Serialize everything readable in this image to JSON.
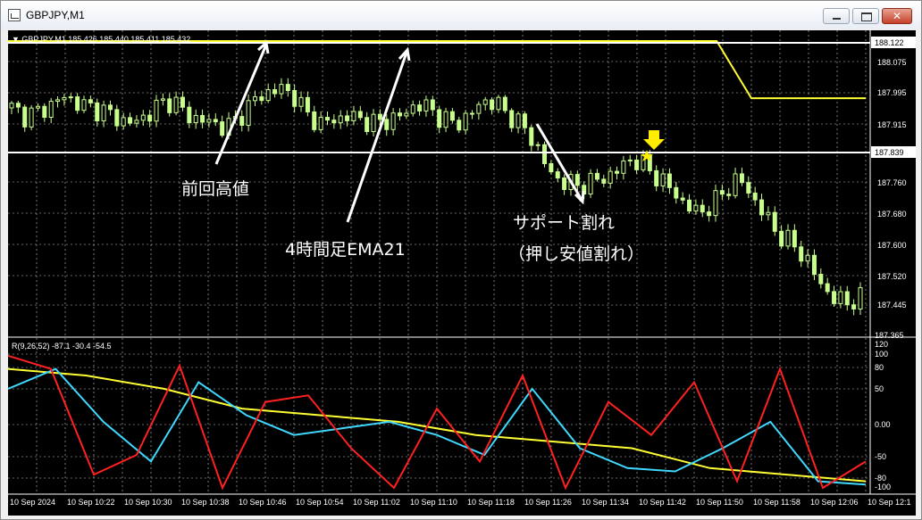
{
  "window": {
    "title": "GBPJPY,M1"
  },
  "main_header": "▼ GBPJPY,M1  185.426 185.440 185.411 185.432",
  "sub_header": "R(9,26,52) -87.1 -30.4 -54.5",
  "price_axis": {
    "ticks": [
      "188.075",
      "187.995",
      "187.915",
      "187.760",
      "187.680",
      "187.600",
      "187.520",
      "187.445",
      "187.365"
    ],
    "resistance_tag": "188.122",
    "support_tag": "187.839"
  },
  "osc_axis": {
    "ticks": [
      "120",
      "100",
      "80",
      "50",
      "0.00",
      "-50",
      "-80",
      "-100"
    ]
  },
  "time_axis": [
    "10 Sep 2024",
    "10 Sep 10:22",
    "10 Sep 10:30",
    "10 Sep 10:38",
    "10 Sep 10:46",
    "10 Sep 10:54",
    "10 Sep 11:02",
    "10 Sep 11:10",
    "10 Sep 11:18",
    "10 Sep 11:26",
    "10 Sep 11:34",
    "10 Sep 11:42",
    "10 Sep 11:50",
    "10 Sep 11:58",
    "10 Sep 12:06",
    "10 Sep 12:1"
  ],
  "annotations": {
    "prev_high": "前回高値",
    "ema_label": "4時間足EMA21",
    "support_break_1": "サポート割れ",
    "support_break_2": "（押し安値割れ）"
  },
  "colors": {
    "background": "#000000",
    "grid": "#c8c8c8",
    "candle": "#c8ff8c",
    "ema": "#ffff33",
    "level": "#ffffff",
    "osc_red": "#ff2020",
    "osc_cyan": "#3fd8ff",
    "osc_yellow": "#ffff33",
    "marker": "#ffee00"
  },
  "icons": {
    "entry_marker": "star-icon",
    "entry_arrow": "down-arrow-icon"
  },
  "chart_data": [
    {
      "type": "candlestick",
      "symbol": "GBPJPY",
      "timeframe": "M1",
      "ylim": [
        187.365,
        188.122
      ],
      "x": [
        "10:14",
        "10:22",
        "10:30",
        "10:38",
        "10:46",
        "10:54",
        "11:02",
        "11:10",
        "11:18",
        "11:26",
        "11:34",
        "11:42",
        "11:50",
        "11:58",
        "12:06",
        "12:14"
      ],
      "close_path": [
        187.95,
        187.93,
        187.94,
        187.96,
        187.98,
        187.96,
        187.95,
        187.94,
        187.92,
        187.91,
        187.93,
        187.96,
        187.97,
        187.93,
        187.92,
        187.91,
        187.9,
        187.93,
        187.97,
        187.99,
        188.0,
        187.98,
        187.93,
        187.91,
        187.92,
        187.93,
        187.92,
        187.91,
        187.92,
        187.93,
        187.96,
        187.95,
        187.92,
        187.91,
        187.93,
        187.97,
        187.96,
        187.93,
        187.9,
        187.85,
        187.78,
        187.76,
        187.75,
        187.76,
        187.77,
        187.79,
        187.82,
        187.8,
        187.77,
        187.74,
        187.7,
        187.68,
        187.7,
        187.74,
        187.77,
        187.72,
        187.67,
        187.62,
        187.6,
        187.56,
        187.5,
        187.46,
        187.45,
        187.46
      ],
      "series": [
        {
          "name": "EMA21 (4H)",
          "values": [
            188.122,
            188.122,
            188.122,
            188.122,
            188.122,
            188.122,
            188.122,
            188.122,
            188.122,
            188.122,
            188.122,
            188.122,
            188.122,
            187.975,
            187.975,
            187.975
          ]
        }
      ],
      "levels": [
        {
          "value": 188.122
        },
        {
          "value": 187.839
        }
      ],
      "markers": [
        {
          "time": "11:38",
          "price": 187.82
        }
      ]
    },
    {
      "type": "line",
      "ylim": [
        -100,
        120
      ],
      "series": [
        {
          "name": "R9",
          "color": "red",
          "values": [
            100,
            80,
            -80,
            -50,
            85,
            -100,
            30,
            40,
            -40,
            -100,
            20,
            -60,
            70,
            -100,
            30,
            -20,
            60,
            -90,
            80,
            -100,
            -60
          ]
        },
        {
          "name": "R26",
          "color": "cyan",
          "values": [
            50,
            80,
            0,
            -60,
            60,
            10,
            -20,
            -10,
            0,
            -20,
            -50,
            50,
            -40,
            -70,
            -75,
            -40,
            0,
            -90,
            -95
          ]
        },
        {
          "name": "R52",
          "color": "yellow",
          "values": [
            80,
            70,
            50,
            20,
            10,
            0,
            -20,
            -30,
            -40,
            -70,
            -80,
            -90
          ]
        }
      ]
    }
  ]
}
